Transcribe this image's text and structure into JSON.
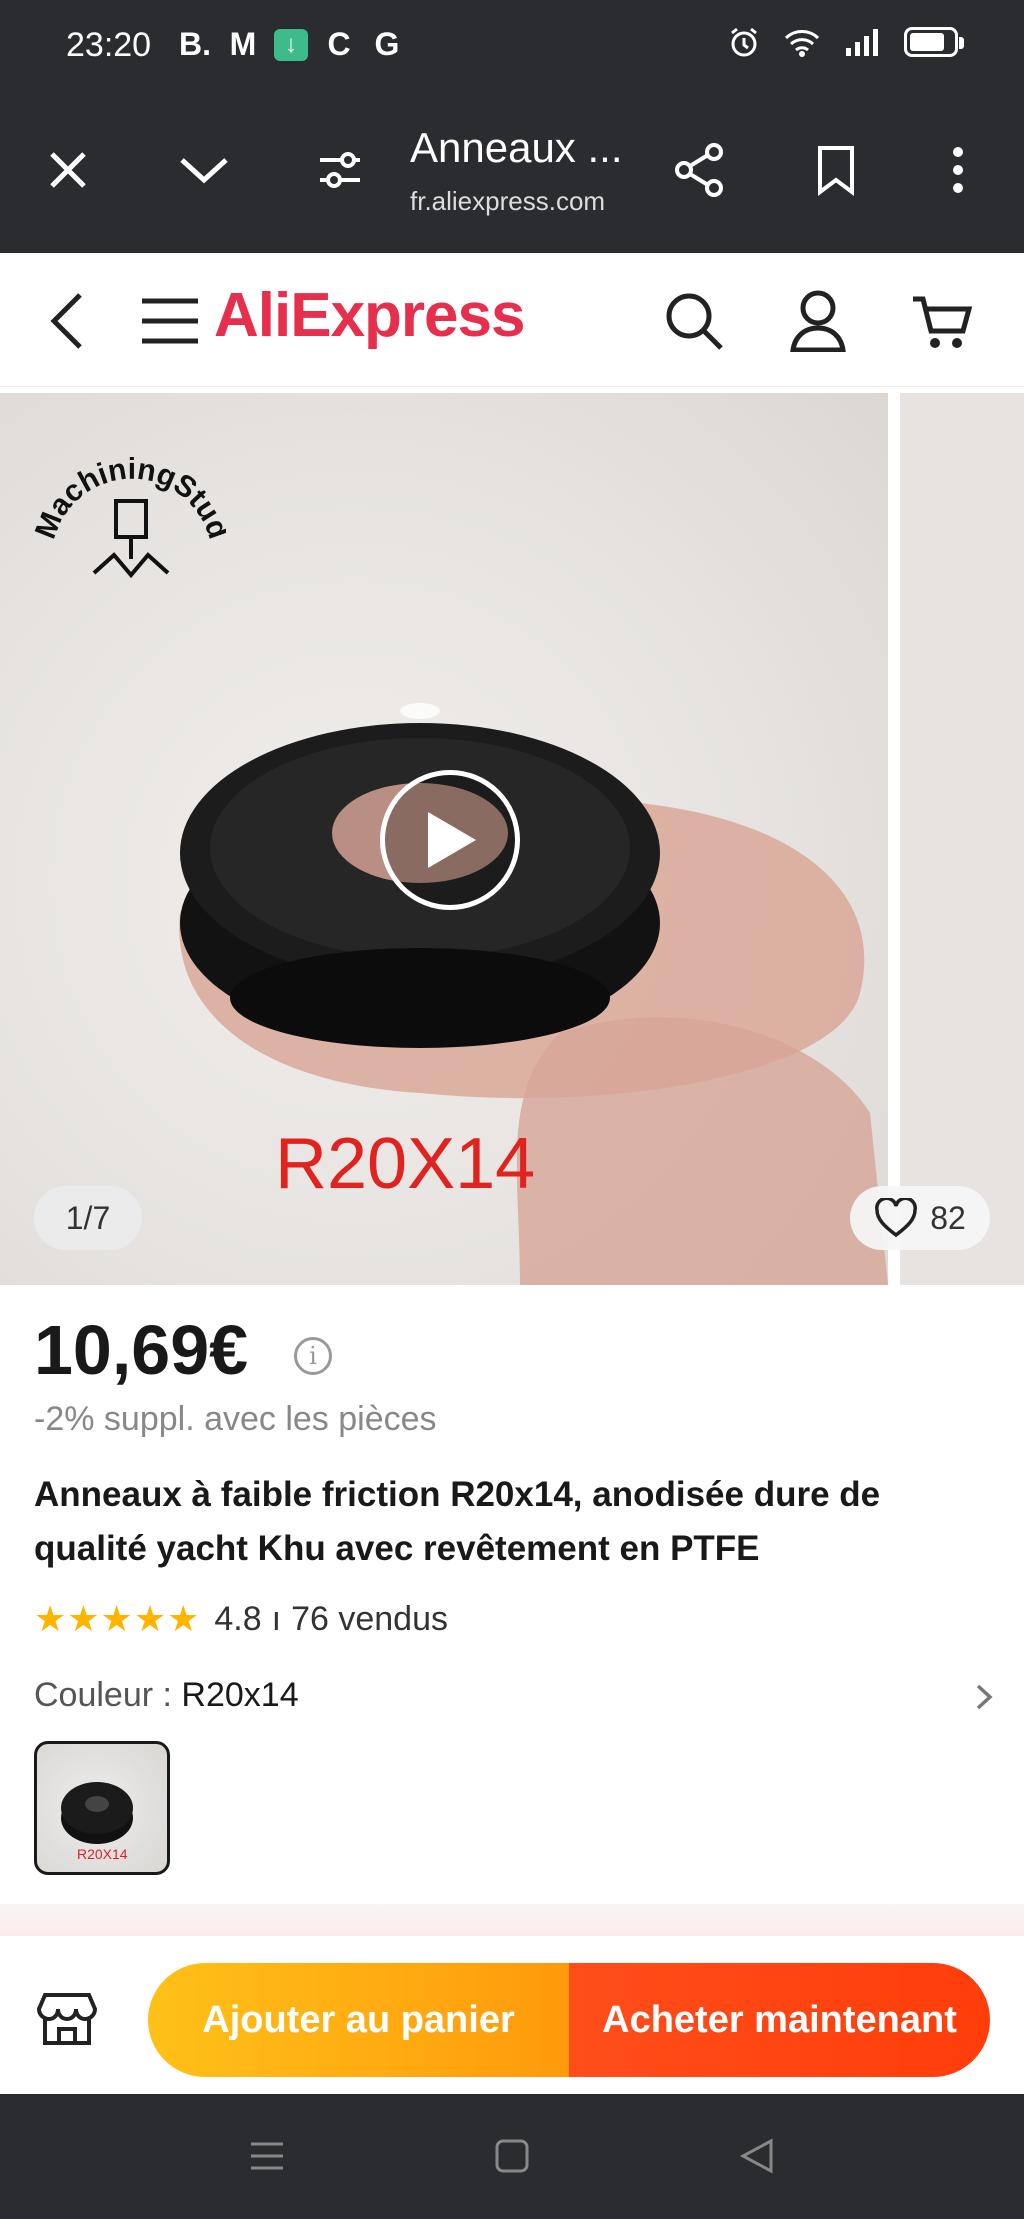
{
  "status_bar": {
    "time": "23:20",
    "app_icons": [
      "B.",
      "M",
      "↓",
      "C",
      "G"
    ]
  },
  "browser": {
    "page_title": "Anneaux ...",
    "url": "fr.aliexpress.com"
  },
  "site": {
    "logo": "AliExpress"
  },
  "gallery": {
    "counter": "1/7",
    "wishlist_count": "82",
    "brand_text": "MachiningStudio",
    "video_label": "R20X14"
  },
  "product": {
    "price": "10,69€",
    "discount": "-2% suppl. avec les pièces",
    "title": "Anneaux à faible friction R20x14, anodisée dure de qualité yacht Khu avec revêtement en PTFE",
    "rating": "4.8",
    "separator": "ı",
    "sold": "76 vendus",
    "color_label": "Couleur : ",
    "color_value": "R20x14",
    "variant_label": "R20X14"
  },
  "actions": {
    "add_to_cart": "Ajouter au panier",
    "buy_now": "Acheter maintenant"
  },
  "colors": {
    "brand": "#e62e4d",
    "cart_gradient": "#ffc118",
    "buy_gradient": "#ff4e1a",
    "star": "#ffb400"
  }
}
